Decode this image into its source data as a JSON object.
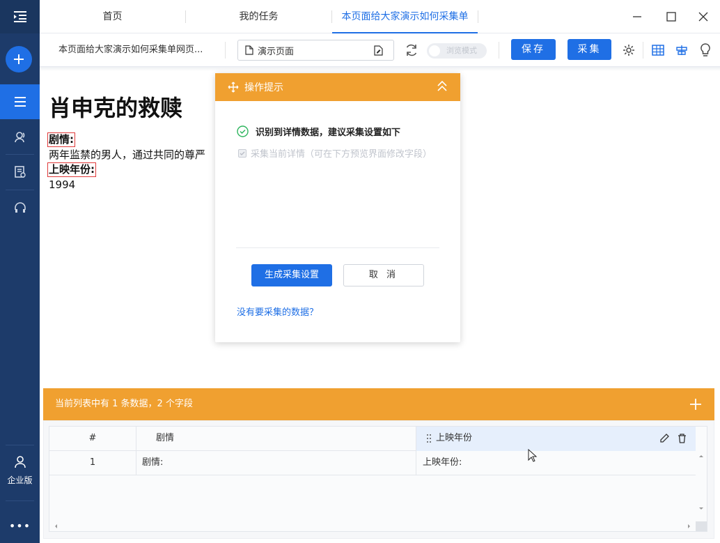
{
  "sidebar": {
    "enterprise_label": "企业版",
    "more_label": "•••"
  },
  "tabs": [
    {
      "label": "首页"
    },
    {
      "label": "我的任务"
    },
    {
      "label": "本页面给大家演示如何采集单"
    }
  ],
  "toolbar": {
    "task_title": "本页面给大家演示如何采集单网页...",
    "url_value": "演示页面",
    "browse_mode_label": "浏览模式",
    "save_label": "保存",
    "collect_label": "采集"
  },
  "page": {
    "title": "肖申克的救赎",
    "plot_label": "剧情:",
    "plot_text": "两年监禁的男人，通过共同的尊严",
    "year_label": "上映年份:",
    "year_value": "1994"
  },
  "popup": {
    "title": "操作提示",
    "detected_text": "识别到详情数据，建议采集设置如下",
    "option_text": "采集当前详情（可在下方预览界面修改字段）",
    "generate_label": "生成采集设置",
    "cancel_label": "取 消",
    "no_data_link": "没有要采集的数据？"
  },
  "data_panel": {
    "summary": "当前列表中有 1 条数据，2 个字段",
    "columns": [
      "#",
      "剧情",
      "上映年份"
    ],
    "rows": [
      {
        "index": "1",
        "plot": "剧情:",
        "year": "上映年份:"
      }
    ]
  },
  "colors": {
    "accent": "#1f6fe5",
    "orange": "#f0a030",
    "sidebar": "#1d3b6a"
  }
}
